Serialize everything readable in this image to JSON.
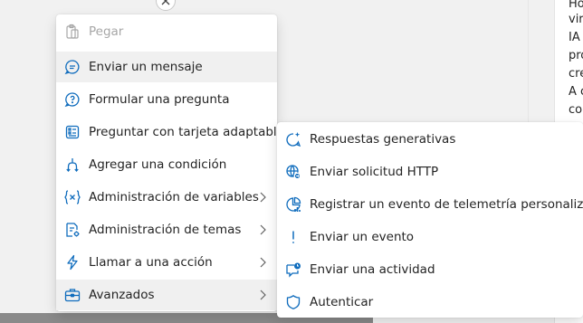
{
  "right_panel": {
    "lines": [
      "Ho",
      "vir",
      "IA",
      "pro",
      "cre",
      "A c",
      "co"
    ]
  },
  "menu": {
    "items": [
      {
        "label": "Pegar",
        "icon": "paste-icon",
        "disabled": true
      },
      {
        "label": "Enviar un mensaje",
        "icon": "message-icon",
        "highlighted": true
      },
      {
        "label": "Formular una pregunta",
        "icon": "question-bubble-icon"
      },
      {
        "label": "Preguntar con tarjeta adaptable",
        "icon": "adaptive-card-icon"
      },
      {
        "label": "Agregar una condición",
        "icon": "branch-icon"
      },
      {
        "label": "Administración de variables",
        "icon": "variable-icon",
        "submenu": true
      },
      {
        "label": "Administración de temas",
        "icon": "topic-settings-icon",
        "submenu": true
      },
      {
        "label": "Llamar a una acción",
        "icon": "lightning-icon",
        "submenu": true
      },
      {
        "label": "Avanzados",
        "icon": "toolbox-icon",
        "submenu": true,
        "highlighted": true
      }
    ]
  },
  "submenu": {
    "items": [
      {
        "label": "Respuestas generativas",
        "icon": "sparkle-chat-icon"
      },
      {
        "label": "Enviar solicitud HTTP",
        "icon": "globe-send-icon"
      },
      {
        "label": "Registrar un evento de telemetría personalizado",
        "icon": "telemetry-chart-icon"
      },
      {
        "label": "Enviar un evento",
        "icon": "exclamation-icon"
      },
      {
        "label": "Enviar una actividad",
        "icon": "activity-chat-icon"
      },
      {
        "label": "Autenticar",
        "icon": "shield-icon"
      }
    ]
  }
}
